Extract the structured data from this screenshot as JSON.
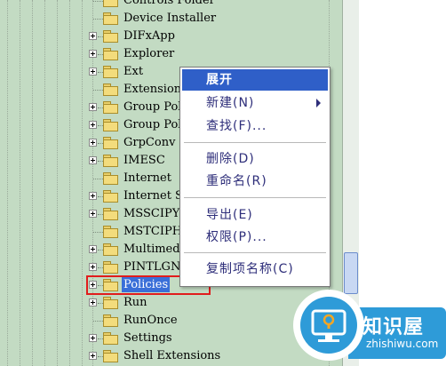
{
  "tree": {
    "items": [
      {
        "label": "Controls Folder",
        "expandable": false
      },
      {
        "label": "Device Installer",
        "expandable": false
      },
      {
        "label": "DIFxApp",
        "expandable": true
      },
      {
        "label": "Explorer",
        "expandable": true
      },
      {
        "label": "Ext",
        "expandable": true
      },
      {
        "label": "Extensions",
        "expandable": false
      },
      {
        "label": "Group Pol",
        "expandable": true
      },
      {
        "label": "Group Pol",
        "expandable": true
      },
      {
        "label": "GrpConv",
        "expandable": true
      },
      {
        "label": "IMESC",
        "expandable": true
      },
      {
        "label": "Internet",
        "expandable": false
      },
      {
        "label": "Internet Se",
        "expandable": true
      },
      {
        "label": "MSSCIPY",
        "expandable": true
      },
      {
        "label": "MSTCIPH",
        "expandable": false
      },
      {
        "label": "Multimedia",
        "expandable": true
      },
      {
        "label": "PINTLGN",
        "expandable": true
      },
      {
        "label": "Policies",
        "expandable": true,
        "selected": true
      },
      {
        "label": "Run",
        "expandable": true
      },
      {
        "label": "RunOnce",
        "expandable": false
      },
      {
        "label": "Settings",
        "expandable": true
      },
      {
        "label": "Shell Extensions",
        "expandable": true
      }
    ]
  },
  "context_menu": {
    "expand": "展开",
    "new": "新建(N)",
    "find": "查找(F)...",
    "delete": "删除(D)",
    "rename": "重命名(R)",
    "export": "导出(E)",
    "permissions": "权限(P)...",
    "copy_key_name": "复制项名称(C)"
  },
  "watermark": {
    "title": "知识屋",
    "subtitle": "zhishiwu.com"
  },
  "colors": {
    "tree_bg": "#c3dbc3",
    "menu_highlight": "#2f5fc8",
    "selection": "#3a6fd8",
    "annotation_box": "#e11c1c",
    "watermark": "#2e9bd8"
  }
}
